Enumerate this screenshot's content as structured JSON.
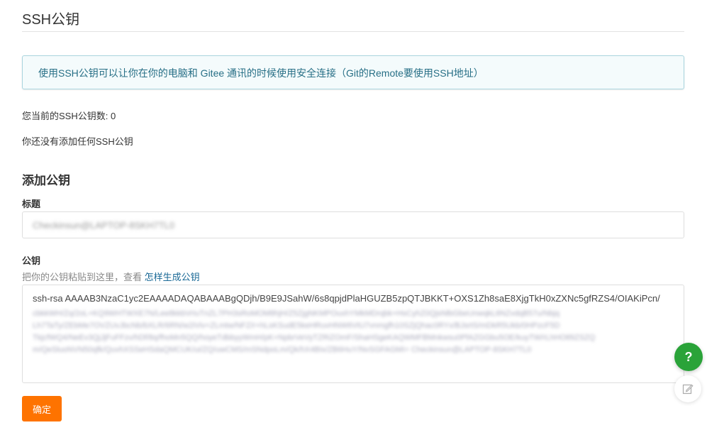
{
  "header": {
    "title": "SSH公钥"
  },
  "info": {
    "text": "使用SSH公钥可以让你在你的电脑和 Gitee 通讯的时候使用安全连接（Git的Remote要使用SSH地址）"
  },
  "status": {
    "key_count": "您当前的SSH公钥数: 0",
    "empty_message": "你还没有添加任何SSH公钥"
  },
  "form": {
    "section_title": "添加公钥",
    "title_label": "标题",
    "title_value": "Checkinsun@LAPTOP-8SKH7TL0",
    "key_label": "公钥",
    "key_hint": "把你的公钥粘贴到这里，查看",
    "key_hint_link": "怎样生成公钥",
    "key_value_visible": "ssh-rsa AAAAB3NzaC1yc2EAAAADAQABAAABgQDjh/B9E9JSahW/6s8qpjdPlaHGUZB5zpQTJBKKT+OXS1Zh8saE8XjgTkH0xZXNc5gfRZS4/OIAKiPcn/",
    "key_value_blurred": [
      "cbkkWH/Zq/2oL+KQ9WHTWXE7N/Lee8kkbVrIuTnZL7PH3sRoMOM8hjH/Z5ZjgNKMPOuxhYMkMDrqbk+HsCyhZ0QjsNlbGbeUnwqkL6NZvdqB57u/Nbjq",
      "Lh7TaTy/ZEbMe7OVZUvJbcNb/bXLR/6RN/w2iViv+ZLmtw/NFZ/r+hLsKSudE5keHRuvHNW6VtU7vnmgfh10SZjQhac0RYx/BJsrtS/mDkR5Ukb/0HPzcF5D",
      "TkjcfWQ4/NeEv3QjJjFuFFzv/hDf/8q/fhoMn5QQ/hoyeTdbbyyWmH/pK+NpbrVeVyTZRiZOmF/ShaHSgeKAQWMFBMnkwsu0PfAZGGbu5OE/kuyTW/rLhHOtl9ZSZQ",
      "m/QeSluoNVN50qfk/QuvhXSSeHSdaQMCUK/ui/ZQ/uwCMS/mSNdpoLm/Qk/hX4BIx/ZB6HuY/NvSGFAGMI= Checkinsun@LAPTOP-8SKH7TL0"
    ],
    "submit_label": "确定"
  },
  "floating": {
    "help_label": "?",
    "feedback_icon": "edit-icon"
  },
  "colors": {
    "accent": "#fe7300",
    "info_text": "#276f86",
    "info_border": "#a9d5de",
    "link": "#1a6996",
    "help_green": "#2aa339"
  }
}
